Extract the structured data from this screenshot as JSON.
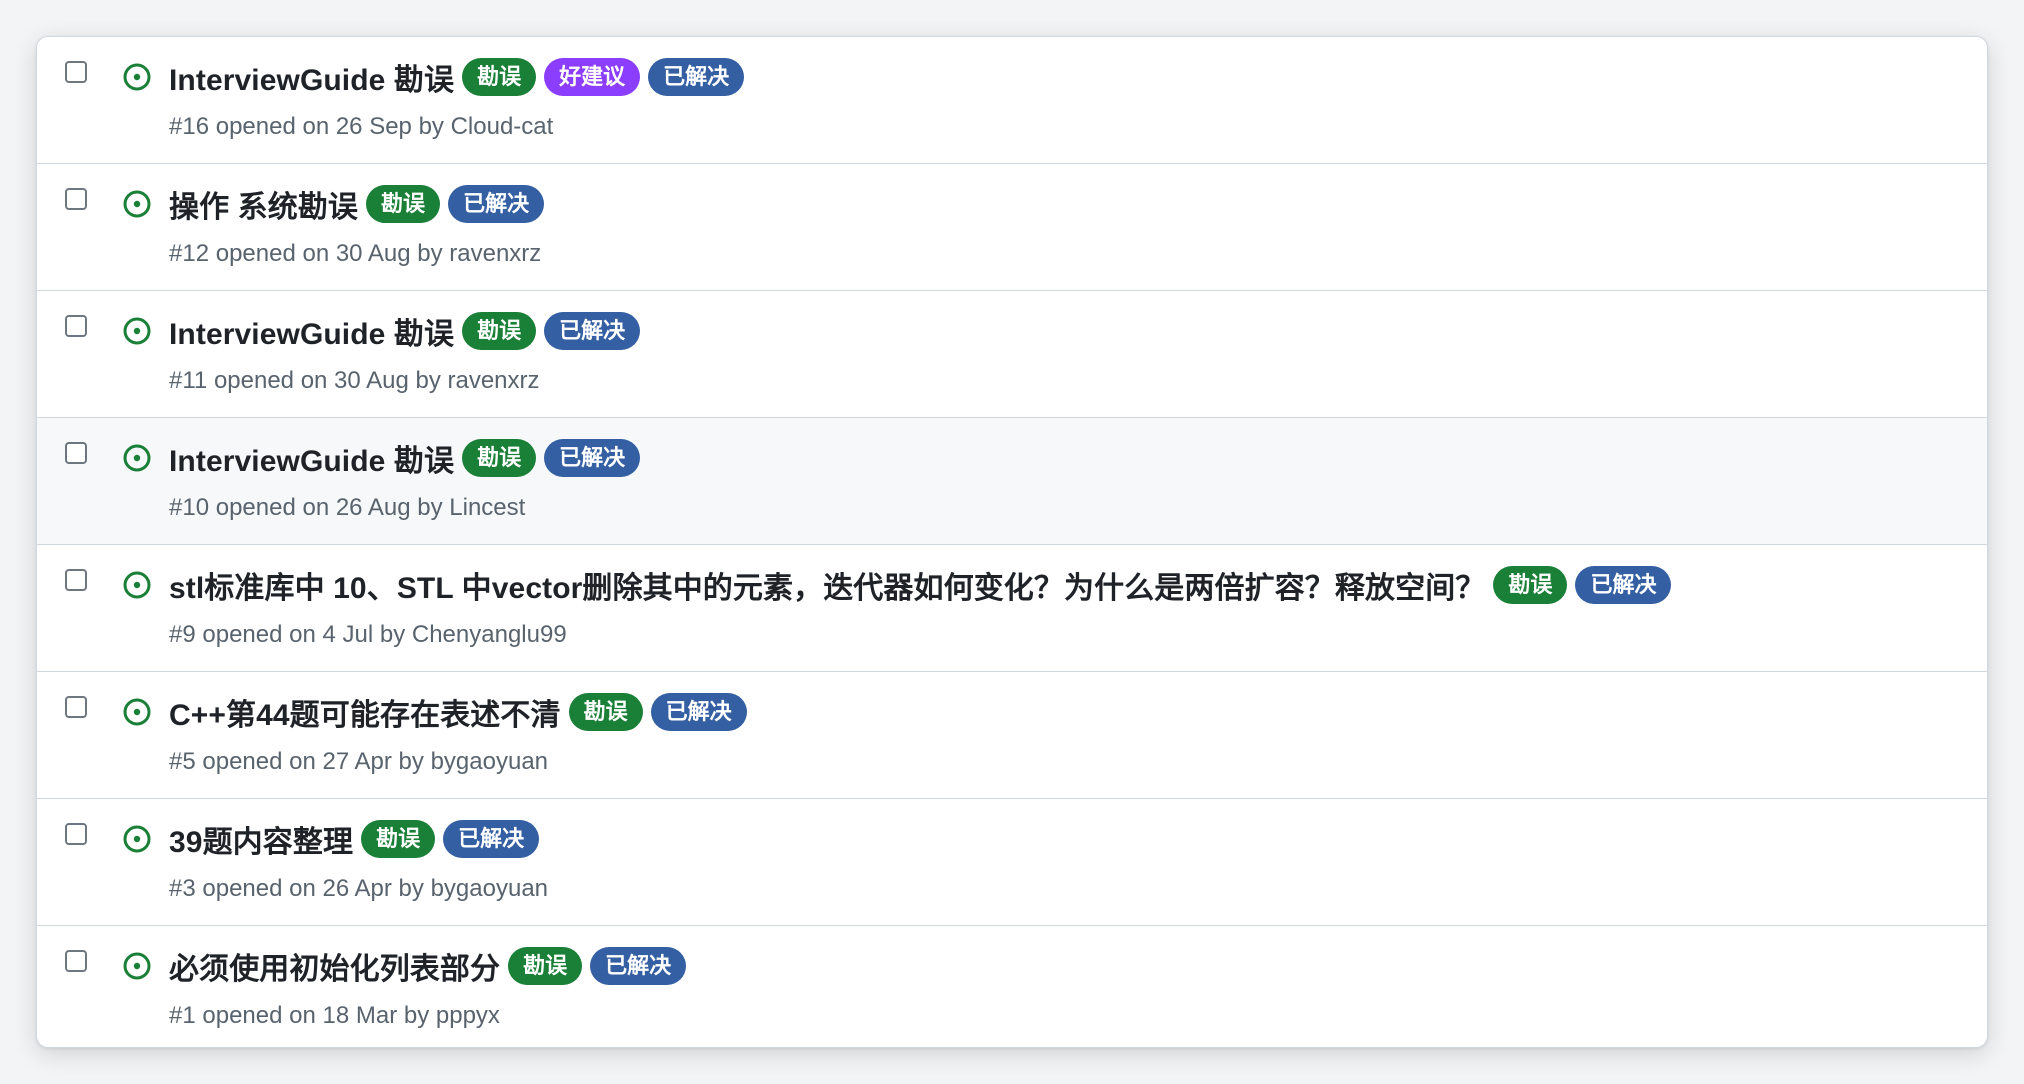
{
  "label_colors": {
    "勘误": "#1a7f37",
    "好建议": "#8c3eff",
    "已解决": "#355fa3"
  },
  "issue_state_color": "#1a7f37",
  "issues": [
    {
      "title": "InterviewGuide 勘误",
      "labels": [
        "勘误",
        "好建议",
        "已解决"
      ],
      "number": "#16",
      "opened_text": "opened on 26 Sep by",
      "author": "Cloud-cat"
    },
    {
      "title": "操作 系统勘误",
      "labels": [
        "勘误",
        "已解决"
      ],
      "number": "#12",
      "opened_text": "opened on 30 Aug by",
      "author": "ravenxrz"
    },
    {
      "title": "InterviewGuide 勘误",
      "labels": [
        "勘误",
        "已解决"
      ],
      "number": "#11",
      "opened_text": "opened on 30 Aug by",
      "author": "ravenxrz"
    },
    {
      "title": "InterviewGuide 勘误",
      "labels": [
        "勘误",
        "已解决"
      ],
      "number": "#10",
      "opened_text": "opened on 26 Aug by",
      "author": "Lincest",
      "hovered": true
    },
    {
      "title": "stl标准库中 10、STL 中vector删除其中的元素，迭代器如何变化？为什么是两倍扩容？释放空间？",
      "labels": [
        "勘误",
        "已解决"
      ],
      "number": "#9",
      "opened_text": "opened on 4 Jul by",
      "author": "Chenyanglu99"
    },
    {
      "title": "C++第44题可能存在表述不清",
      "labels": [
        "勘误",
        "已解决"
      ],
      "number": "#5",
      "opened_text": "opened on 27 Apr by",
      "author": "bygaoyuan"
    },
    {
      "title": "39题内容整理",
      "labels": [
        "勘误",
        "已解决"
      ],
      "number": "#3",
      "opened_text": "opened on 26 Apr by",
      "author": "bygaoyuan"
    },
    {
      "title": "必须使用初始化列表部分",
      "labels": [
        "勘误",
        "已解决"
      ],
      "number": "#1",
      "opened_text": "opened on 18 Mar by",
      "author": "pppyx"
    }
  ]
}
